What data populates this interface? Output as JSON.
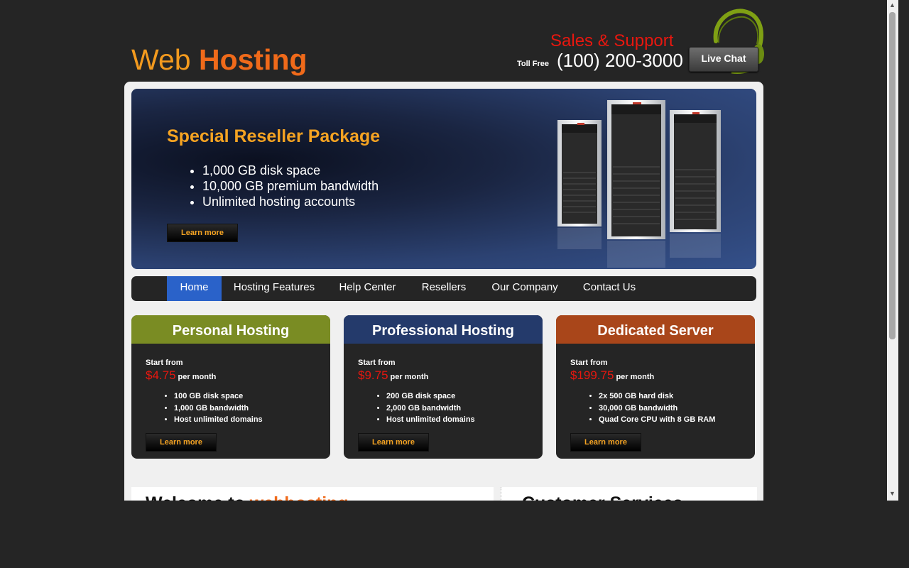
{
  "header": {
    "logo_part1": "Web",
    "logo_part2": "Hosting",
    "sales_title": "Sales & Support",
    "toll_free_label": "Toll Free",
    "phone": "(100) 200-3000",
    "live_chat": "Live Chat"
  },
  "banner": {
    "title": "Special Reseller Package",
    "features": [
      "1,000 GB disk space",
      "10,000 GB premium bandwidth",
      "Unlimited hosting accounts"
    ],
    "button": "Learn more"
  },
  "nav": {
    "items": [
      "Home",
      "Hosting Features",
      "Help Center",
      "Resellers",
      "Our Company",
      "Contact Us"
    ],
    "active": "Home",
    "active_color": "#2a62c9"
  },
  "plans": [
    {
      "title": "Personal Hosting",
      "start_label": "Start from",
      "price": "$4.75",
      "per": "per month",
      "features": [
        "100 GB disk space",
        "1,000 GB bandwidth",
        "Host unlimited domains"
      ],
      "button": "Learn more",
      "color": "#7a8c23"
    },
    {
      "title": "Professional Hosting",
      "start_label": "Start from",
      "price": "$9.75",
      "per": "per month",
      "features": [
        "200 GB disk space",
        "2,000 GB bandwidth",
        "Host unlimited domains"
      ],
      "button": "Learn more",
      "color": "#243a6b"
    },
    {
      "title": "Dedicated Server",
      "start_label": "Start from",
      "price": "$199.75",
      "per": "per month",
      "features": [
        "2x 500 GB hard disk",
        "30,000 GB bandwidth",
        "Quad Core CPU with 8 GB RAM"
      ],
      "button": "Learn more",
      "color": "#a9461a"
    }
  ],
  "bottom": {
    "welcome_prefix": "Welcome to",
    "welcome_highlight": "webhosting",
    "customer_services": "Customer Services"
  },
  "colors": {
    "page_background": "#252525",
    "panel_background": "#f0f0f0",
    "accent_orange": "#f06a1a",
    "price_red": "#e8170f"
  },
  "icons": {
    "headset": "headset-icon",
    "scroll_up": "scroll-up-arrow-icon",
    "scroll_down": "scroll-down-arrow-icon",
    "servers": "server-towers-image"
  }
}
